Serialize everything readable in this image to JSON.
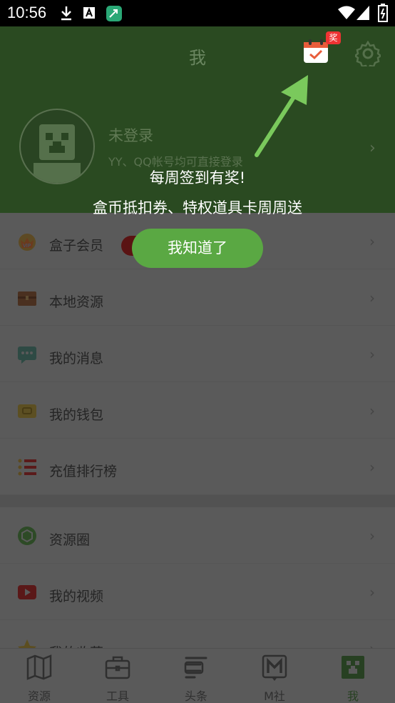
{
  "status_bar": {
    "time": "10:56"
  },
  "header": {
    "title": "我",
    "badge": "奖",
    "login_title": "未登录",
    "login_subtitle": "YY、QQ帐号均可直接登录",
    "chevron": "›"
  },
  "menu": {
    "group1": [
      {
        "label": "盒子会员",
        "icon": "vip-crown-icon"
      },
      {
        "label": "本地资源",
        "icon": "chest-icon"
      },
      {
        "label": "我的消息",
        "icon": "message-icon"
      },
      {
        "label": "我的钱包",
        "icon": "wallet-icon"
      },
      {
        "label": "充值排行榜",
        "icon": "ranking-icon"
      }
    ],
    "group2": [
      {
        "label": "资源圈",
        "icon": "cube-circle-icon"
      },
      {
        "label": "我的视频",
        "icon": "video-play-icon"
      },
      {
        "label": "我的收藏",
        "icon": "star-icon"
      }
    ],
    "chevron": "›"
  },
  "tip": {
    "line1": "每周签到有奖!",
    "line2": "盒币抵扣券、特权道具卡周周送",
    "button": "我知道了"
  },
  "bottom_nav": [
    {
      "label": "资源",
      "icon": "map-icon"
    },
    {
      "label": "工具",
      "icon": "toolbox-icon"
    },
    {
      "label": "头条",
      "icon": "headline-icon"
    },
    {
      "label": "M社",
      "icon": "m-community-icon"
    },
    {
      "label": "我",
      "icon": "creeper-face-icon",
      "active": true
    }
  ],
  "colors": {
    "accent": "#5aa843",
    "badge": "#ee3333"
  }
}
